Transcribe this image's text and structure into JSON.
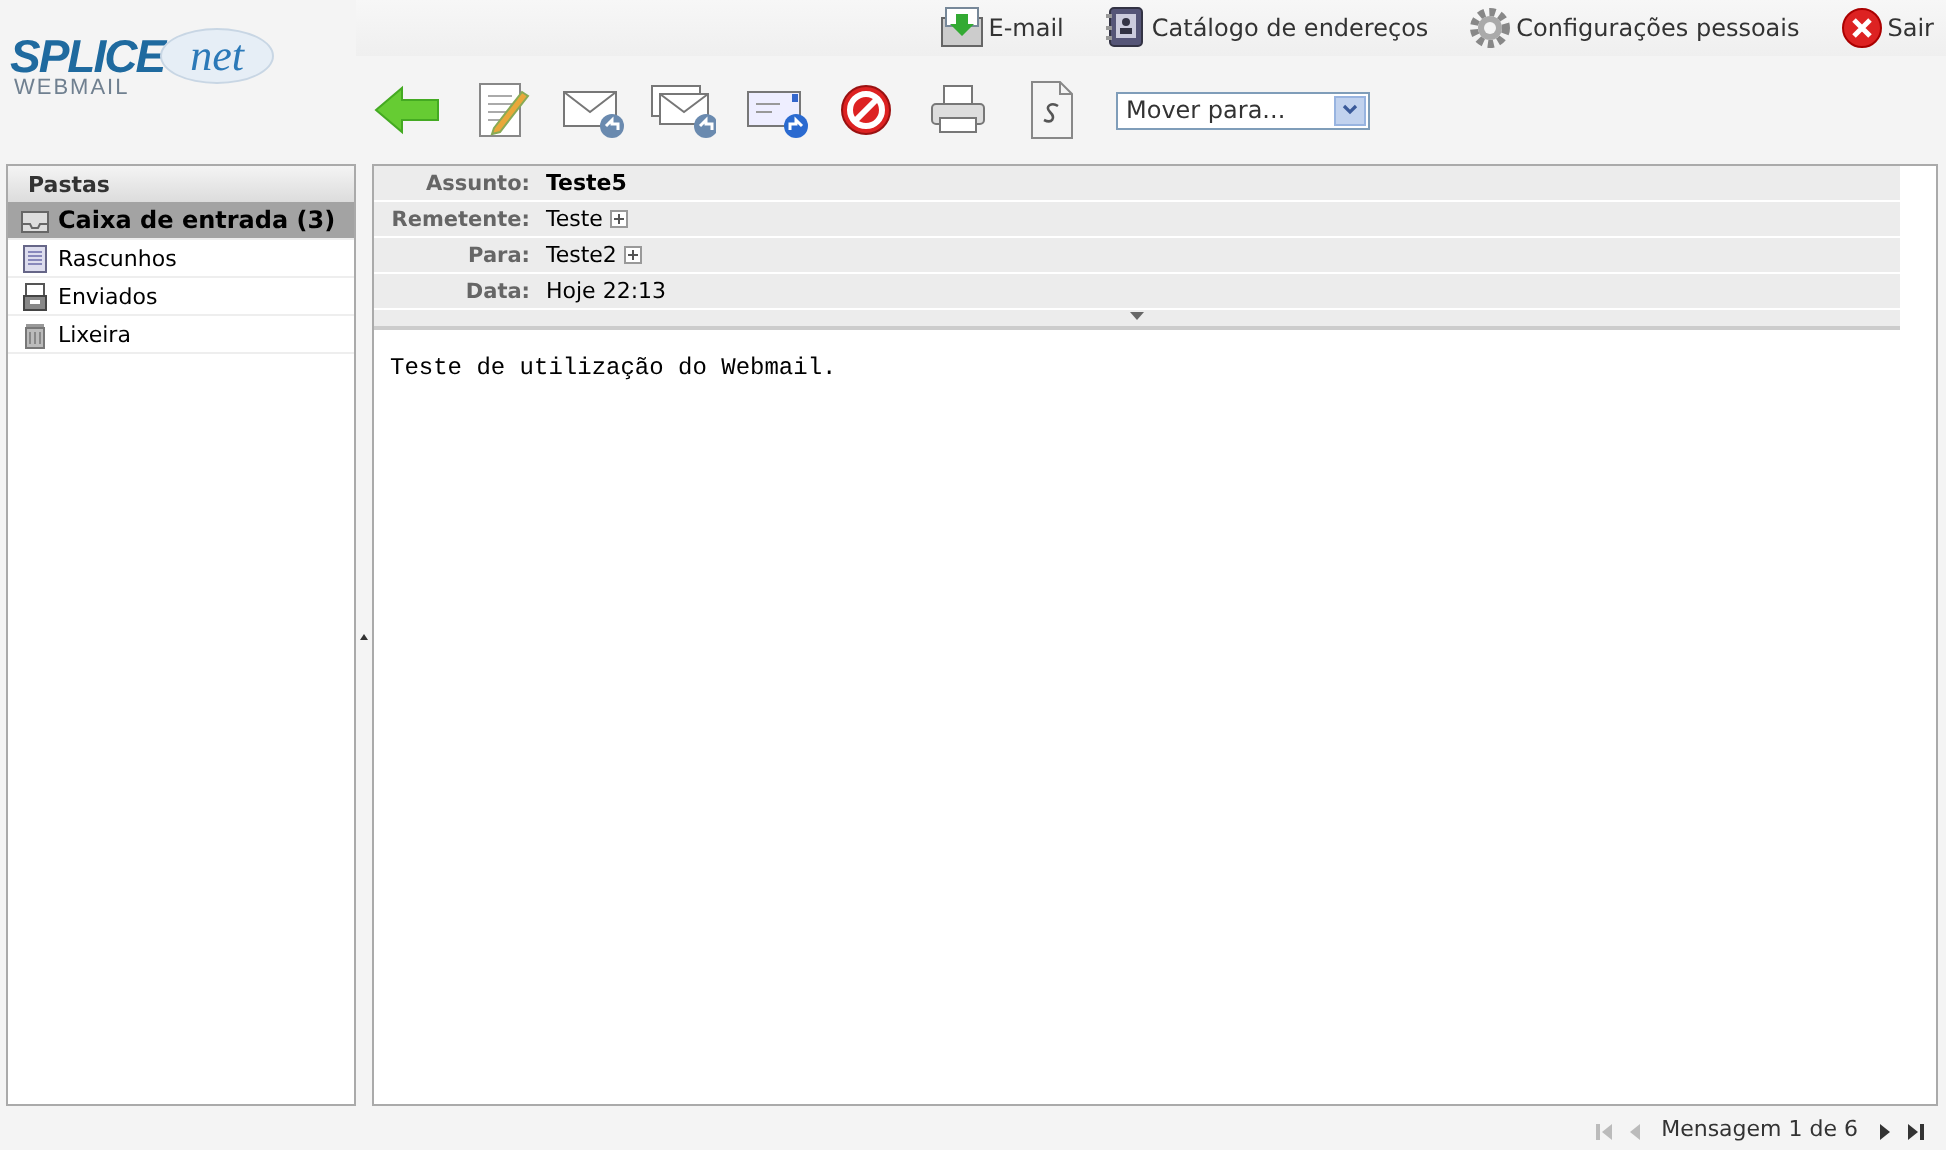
{
  "logo": {
    "brand": "SPLICE",
    "accent": "net",
    "sub": "WEBMAIL"
  },
  "top_links": [
    {
      "kind": "email",
      "label": "E-mail"
    },
    {
      "kind": "contacts",
      "label": "Catálogo de endereços"
    },
    {
      "kind": "settings",
      "label": "Configurações pessoais"
    },
    {
      "kind": "logout",
      "label": "Sair"
    }
  ],
  "toolbar": [
    {
      "kind": "back"
    },
    {
      "kind": "compose"
    },
    {
      "kind": "reply"
    },
    {
      "kind": "reply-all"
    },
    {
      "kind": "forward"
    },
    {
      "kind": "delete"
    },
    {
      "kind": "print"
    },
    {
      "kind": "source"
    }
  ],
  "move_select": {
    "value": "Mover para..."
  },
  "sidebar": {
    "title": "Pastas",
    "items": [
      {
        "kind": "inbox",
        "label": "Caixa de entrada (3)",
        "selected": true
      },
      {
        "kind": "drafts",
        "label": "Rascunhos",
        "selected": false
      },
      {
        "kind": "sent",
        "label": "Enviados",
        "selected": false
      },
      {
        "kind": "trash",
        "label": "Lixeira",
        "selected": false
      }
    ]
  },
  "headers": [
    {
      "label": "Assunto:",
      "value": "Teste5",
      "bold": true,
      "expand": false
    },
    {
      "label": "Remetente:",
      "value": "Teste",
      "bold": false,
      "expand": true
    },
    {
      "label": "Para:",
      "value": "Teste2",
      "bold": false,
      "expand": true
    },
    {
      "label": "Data:",
      "value": "Hoje 22:13",
      "bold": false,
      "expand": false
    }
  ],
  "body": "Teste de utilização do Webmail.",
  "pager": {
    "text": "Mensagem 1 de 6",
    "first_disabled": true,
    "prev_disabled": true,
    "next_disabled": false,
    "last_disabled": false
  }
}
